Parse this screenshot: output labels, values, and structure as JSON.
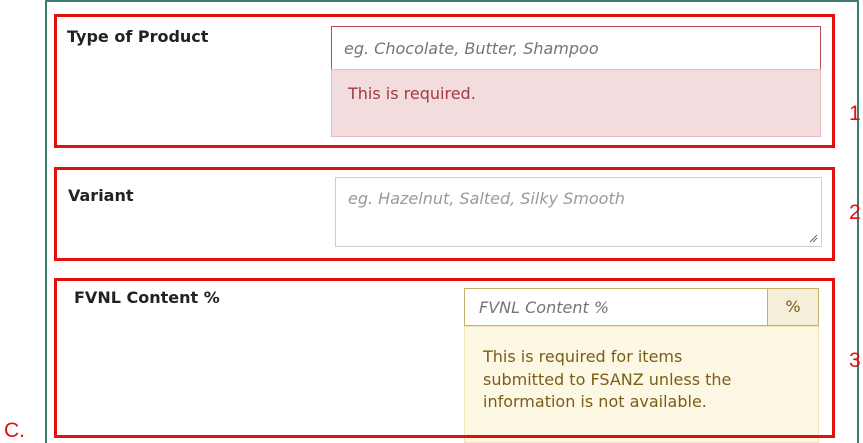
{
  "fields": {
    "type_of_product": {
      "label": "Type of Product",
      "placeholder": "eg. Chocolate, Butter, Shampoo",
      "error": "This is required."
    },
    "variant": {
      "label": "Variant",
      "placeholder": "eg. Hazelnut, Salted, Silky Smooth"
    },
    "fvnl_content": {
      "label": "FVNL Content %",
      "placeholder": "FVNL Content %",
      "addon": "%",
      "warning_lines": [
        "This is required for items",
        "submitted to FSANZ unless the",
        "information is not available."
      ]
    }
  },
  "annotations": {
    "markers": [
      "1",
      "2",
      "3"
    ],
    "corner_label": "C."
  },
  "colors": {
    "callout_border": "#e01010",
    "frame_border": "#3c7a72",
    "error_bg": "#f2dcde",
    "error_text": "#a33a40",
    "warning_bg": "#fcf8e3",
    "warning_text": "#7a5d16"
  }
}
